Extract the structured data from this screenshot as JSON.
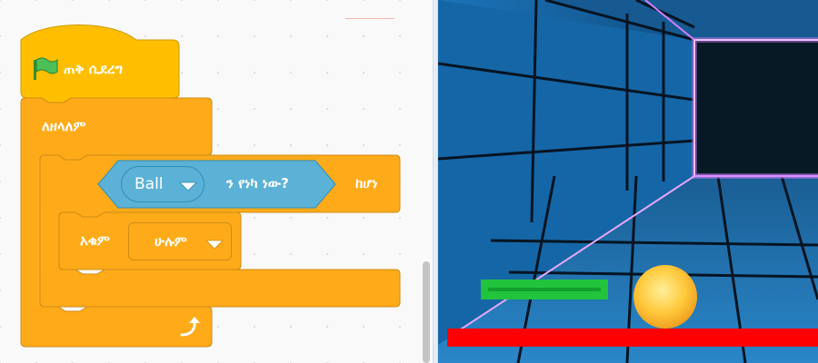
{
  "script": {
    "hat_label": "ጠቅ ሲደረግ",
    "forever_label": "ለዘላለም",
    "if_then_label": "ከሆነ",
    "sensing": {
      "object": "Ball",
      "suffix": "ን የነካ ነው?"
    },
    "stop": {
      "label": "አቁም",
      "option": "ሁሉም"
    }
  },
  "icons": {
    "flag": "green-flag-icon",
    "dropdown": "dropdown-arrow-icon",
    "loop": "loop-arrow-icon"
  },
  "colors": {
    "events_block": "#ffbf00",
    "control_block": "#ffab19",
    "sensing_block": "#5cb1d6",
    "paddle": "#21c43c",
    "ball": "#ffc93c",
    "floor_bar": "#ff0000",
    "tunnel_glow": "#d37cff"
  }
}
